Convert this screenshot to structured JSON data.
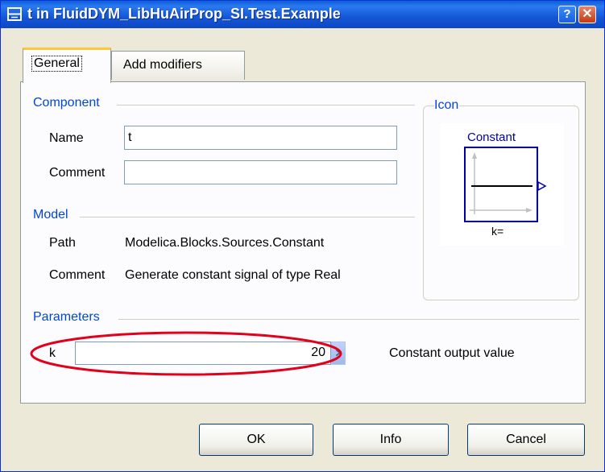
{
  "window": {
    "title": "t in FluidDYM_LibHuAirProp_SI.Test.Example",
    "help_label": "?",
    "close_label": "✕"
  },
  "tabs": [
    {
      "label": "General"
    },
    {
      "label": "Add modifiers"
    }
  ],
  "component": {
    "heading": "Component",
    "name_label": "Name",
    "name_value": "t",
    "comment_label": "Comment",
    "comment_value": ""
  },
  "model": {
    "heading": "Model",
    "path_label": "Path",
    "path_value": "Modelica.Blocks.Sources.Constant",
    "comment_label": "Comment",
    "comment_value": "Generate constant signal of type Real"
  },
  "icon": {
    "heading": "Icon",
    "block_title": "Constant",
    "block_param": "k="
  },
  "parameters": {
    "heading": "Parameters",
    "name": "k",
    "value": "20",
    "description": "Constant output value"
  },
  "buttons": {
    "ok": "OK",
    "info": "Info",
    "cancel": "Cancel"
  },
  "colors": {
    "titlebar": "#0d46c5",
    "group_label": "#0046d5",
    "highlight_ellipse": "#e3001b",
    "block_border": "#0000a0"
  }
}
